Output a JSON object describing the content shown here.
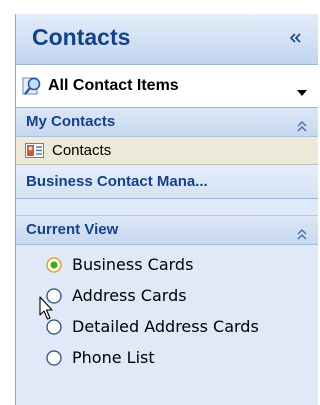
{
  "header": {
    "title": "Contacts",
    "collapse_glyph": "«"
  },
  "selector": {
    "label": "All Contact Items",
    "icon": "magnifier-contacts-icon"
  },
  "my_contacts": {
    "title": "My Contacts",
    "items": [
      {
        "label": "Contacts",
        "icon": "contact-card-icon"
      }
    ]
  },
  "shared_link": {
    "label": "Business Contact Mana..."
  },
  "current_view": {
    "title": "Current View",
    "options": [
      {
        "label": "Business Cards",
        "selected": true
      },
      {
        "label": "Address Cards",
        "selected": false
      },
      {
        "label": "Detailed Address Cards",
        "selected": false
      },
      {
        "label": "Phone List",
        "selected": false
      }
    ]
  },
  "colors": {
    "accent": "#15428b",
    "pane_bg": "#dfe9f7",
    "selected_item_bg": "#ece9d8",
    "radio_selected": "#2eae2e"
  }
}
